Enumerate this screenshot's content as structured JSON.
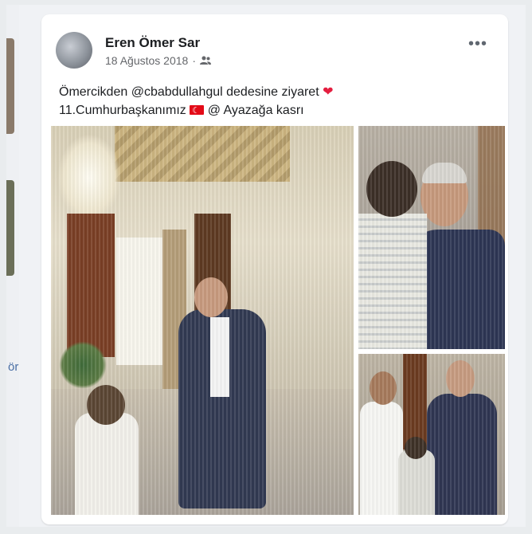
{
  "post": {
    "author": "Eren Ömer Sar",
    "date": "18 Ağustos 2018",
    "separator": "·",
    "text_line1": "Ömercikden @cbabdullahgul dedesine ziyaret",
    "heart": "❤",
    "text_line2": "11.Cumhurbaşkanımız",
    "text_line2_end": " @ Ayazağa kasrı",
    "more": "•••"
  },
  "left_strip": {
    "text": "ör"
  },
  "icons": {
    "audience": "friends-icon",
    "flag": "turkey-flag-icon",
    "heart": "heart-icon"
  },
  "colors": {
    "accent": "#1877f2",
    "heart": "#e41e3f"
  }
}
